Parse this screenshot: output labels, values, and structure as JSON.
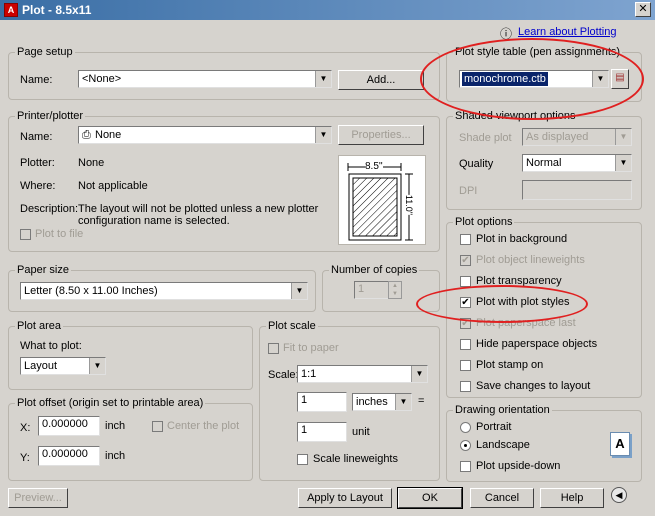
{
  "window": {
    "title": "Plot - 8.5x11",
    "close_glyph": "✕",
    "app_glyph": "A"
  },
  "help": {
    "icon": "ⓘ",
    "link": "Learn about Plotting"
  },
  "page_setup": {
    "group": "Page setup",
    "name_label": "Name:",
    "name_value": "<None>",
    "add_button": "Add..."
  },
  "printer": {
    "group": "Printer/plotter",
    "name_label": "Name:",
    "printer_glyph": "⎙",
    "name_value": "None",
    "properties_button": "Properties...",
    "plotter_label": "Plotter:",
    "plotter_value": "None",
    "where_label": "Where:",
    "where_value": "Not applicable",
    "description_label": "Description:",
    "description_value_line1": "The layout will not be plotted unless a new plotter",
    "description_value_line2": "configuration name is selected.",
    "plot_to_file": "Plot to file",
    "preview_width": "8.5''",
    "preview_height": "11.0''"
  },
  "paper_size": {
    "group": "Paper size",
    "value": "Letter (8.50 x 11.00 Inches)"
  },
  "copies": {
    "group": "Number of copies",
    "value": "1"
  },
  "plot_area": {
    "group": "Plot area",
    "what_label": "What to plot:",
    "value": "Layout"
  },
  "plot_scale": {
    "group": "Plot scale",
    "fit_to_paper": "Fit to paper",
    "scale_label": "Scale:",
    "scale_value": "1:1",
    "num": "1",
    "unit1": "inches",
    "eq": "=",
    "den": "1",
    "unit2": "unit",
    "lineweights": "Scale lineweights"
  },
  "plot_offset": {
    "group": "Plot offset (origin set to printable area)",
    "x_label": "X:",
    "x_value": "0.000000",
    "x_unit": "inch",
    "y_label": "Y:",
    "y_value": "0.000000",
    "y_unit": "inch",
    "center": "Center the plot"
  },
  "pen": {
    "group": "Plot style table (pen assignments)",
    "value": "monochrome.ctb"
  },
  "shaded": {
    "group": "Shaded viewport options",
    "shade_label": "Shade plot",
    "shade_value": "As displayed",
    "quality_label": "Quality",
    "quality_value": "Normal",
    "dpi_label": "DPI"
  },
  "plot_options": {
    "group": "Plot options",
    "items": [
      {
        "label": "Plot in background",
        "checked": "",
        "disabled": false
      },
      {
        "label": "Plot object lineweights",
        "checked": "✔",
        "disabled": true
      },
      {
        "label": "Plot transparency",
        "checked": "",
        "disabled": false
      },
      {
        "label": "Plot with plot styles",
        "checked": "✔",
        "disabled": false
      },
      {
        "label": "Plot paperspace last",
        "checked": "✔",
        "disabled": true
      },
      {
        "label": "Hide paperspace objects",
        "checked": "",
        "disabled": false
      },
      {
        "label": "Plot stamp on",
        "checked": "",
        "disabled": false
      },
      {
        "label": "Save changes to layout",
        "checked": "",
        "disabled": false
      }
    ]
  },
  "orientation": {
    "group": "Drawing orientation",
    "portrait": "Portrait",
    "landscape": "Landscape",
    "upside": "Plot upside-down",
    "orient_glyph": "A"
  },
  "footer": {
    "preview": "Preview...",
    "apply": "Apply to Layout",
    "ok": "OK",
    "cancel": "Cancel",
    "help": "Help",
    "expand_glyph": "◀"
  },
  "colors": {
    "annotation": "#e02020",
    "title_bar": "#3a6ea5",
    "dialog": "#d6d3ce"
  }
}
